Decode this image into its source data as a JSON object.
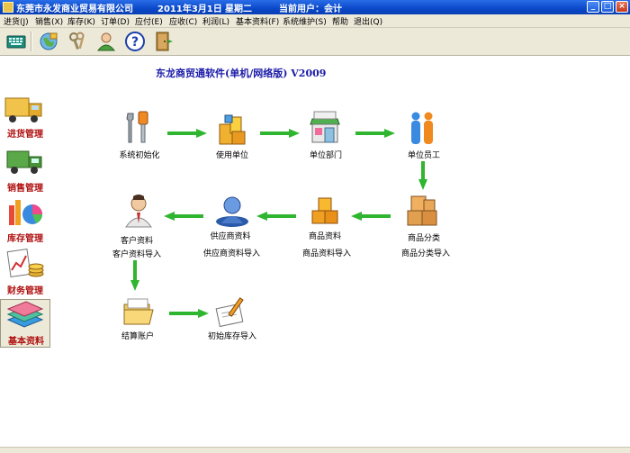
{
  "titlebar": {
    "company": "东莞市永发商业贸易有限公司",
    "date": "2011年3月1日",
    "weekday": "星期二",
    "user_label": "当前用户：会计",
    "buttons": [
      "_",
      "□",
      "×"
    ]
  },
  "menu": [
    "进货(J)",
    "销售(X)",
    "库存(K)",
    "订单(D)",
    "应付(E)",
    "应收(C)",
    "利润(L)",
    "基本资料(F)",
    "系统维护(S)",
    "帮助",
    "退出(Q)"
  ],
  "toolbar": {
    "icons": [
      "keyboard-icon",
      "globe-icon",
      "keys-icon",
      "user-icon",
      "help-icon",
      "exit-door-icon"
    ]
  },
  "app_title": "东龙商贸通软件(单机/网络版)  V2009",
  "sidebar": [
    {
      "label": "进货管理",
      "icon": "truck-icon"
    },
    {
      "label": "销售管理",
      "icon": "delivery-truck-icon"
    },
    {
      "label": "库存管理",
      "icon": "pie-chart-icon"
    },
    {
      "label": "财务管理",
      "icon": "finance-chart-icon"
    },
    {
      "label": "基本资料",
      "icon": "base-data-icon"
    }
  ],
  "flow": {
    "system_init": "系统初始化",
    "use_unit": "使用单位",
    "unit_dept": "单位部门",
    "unit_staff": "单位员工",
    "goods_category": "商品分类",
    "goods_category_import": "商品分类导入",
    "goods_info": "商品资料",
    "goods_info_import": "商品资料导入",
    "supplier_info": "供应商资料",
    "supplier_info_import": "供应商资料导入",
    "customer_info": "客户资料",
    "customer_info_import": "客户资料导入",
    "settlement_account": "结算账户",
    "initial_stock_import": "初始库存导入"
  },
  "colors": {
    "title_blue": "#0a48c8",
    "menu_bg": "#ece9d8",
    "side_label": "#b01010",
    "arrow_green": "#2fb52f",
    "app_title": "#1a1aa8"
  }
}
